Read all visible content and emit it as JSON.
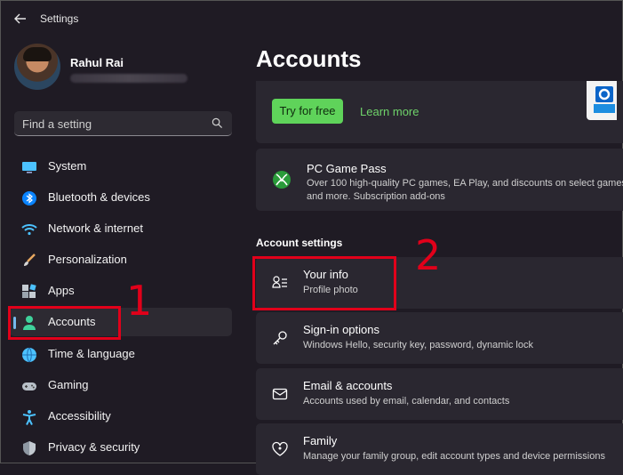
{
  "window": {
    "title": "Settings"
  },
  "user": {
    "name": "Rahul Rai"
  },
  "search": {
    "placeholder": "Find a setting"
  },
  "sidebar": {
    "items": [
      {
        "label": "System",
        "icon": "monitor-icon",
        "active": false
      },
      {
        "label": "Bluetooth & devices",
        "icon": "bluetooth-icon",
        "active": false
      },
      {
        "label": "Network & internet",
        "icon": "wifi-icon",
        "active": false
      },
      {
        "label": "Personalization",
        "icon": "brush-icon",
        "active": false
      },
      {
        "label": "Apps",
        "icon": "apps-icon",
        "active": false
      },
      {
        "label": "Accounts",
        "icon": "person-icon",
        "active": true
      },
      {
        "label": "Time & language",
        "icon": "globe-clock-icon",
        "active": false
      },
      {
        "label": "Gaming",
        "icon": "gamepad-icon",
        "active": false
      },
      {
        "label": "Accessibility",
        "icon": "accessibility-icon",
        "active": false
      },
      {
        "label": "Privacy & security",
        "icon": "shield-icon",
        "active": false
      }
    ]
  },
  "main": {
    "title": "Accounts",
    "promo": {
      "try_label": "Try for free",
      "learn_label": "Learn more"
    },
    "game_pass": {
      "title": "PC Game Pass",
      "description": "Over 100 high-quality PC games, EA Play, and discounts on select games and more. Subscription add-ons"
    },
    "section_label": "Account settings",
    "rows": [
      {
        "title": "Your info",
        "subtitle": "Profile photo",
        "icon": "person-list-icon"
      },
      {
        "title": "Sign-in options",
        "subtitle": "Windows Hello, security key, password, dynamic lock",
        "icon": "key-icon"
      },
      {
        "title": "Email & accounts",
        "subtitle": "Accounts used by email, calendar, and contacts",
        "icon": "mail-icon"
      },
      {
        "title": "Family",
        "subtitle": "Manage your family group, edit account types and device permissions",
        "icon": "heart-people-icon"
      }
    ]
  },
  "annotations": {
    "step1": "1",
    "step2": "2"
  },
  "colors": {
    "accent": "#76b9ed",
    "highlight": "#e1001a",
    "green": "#5fd35a"
  }
}
